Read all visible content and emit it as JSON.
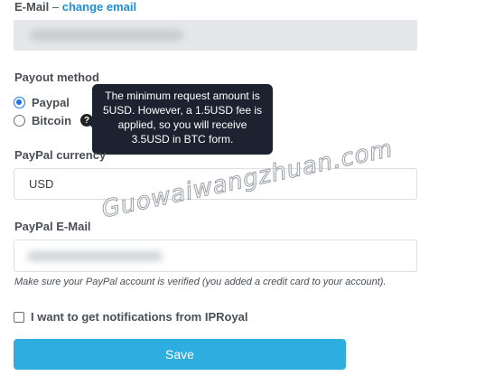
{
  "email": {
    "label": "E-Mail",
    "separator": " – ",
    "change_link": "change email"
  },
  "payout": {
    "label": "Payout method",
    "options": [
      {
        "label": "Paypal",
        "checked": true
      },
      {
        "label": "Bitcoin",
        "checked": false
      }
    ],
    "help_icon": "question-icon",
    "tooltip_lines": [
      "The minimum request amount is",
      "5USD. However, a 1.5USD fee is",
      "applied, so you will receive",
      "3.5USD in BTC form."
    ]
  },
  "currency": {
    "label": "PayPal currency",
    "value": "USD"
  },
  "paypal_email": {
    "label": "PayPal E-Mail",
    "hint": "Make sure your PayPal account is verified (you added a credit card to your account)."
  },
  "notifications": {
    "label": "I want to get notifications from IPRoyal",
    "checked": false
  },
  "save_button": "Save",
  "watermark": "Guowaiwangzhuan.com",
  "colors": {
    "accent": "#2eaee0",
    "link": "#1f8fcf",
    "tooltip_bg": "#1c2230",
    "radio_checked": "#1a73e8"
  }
}
